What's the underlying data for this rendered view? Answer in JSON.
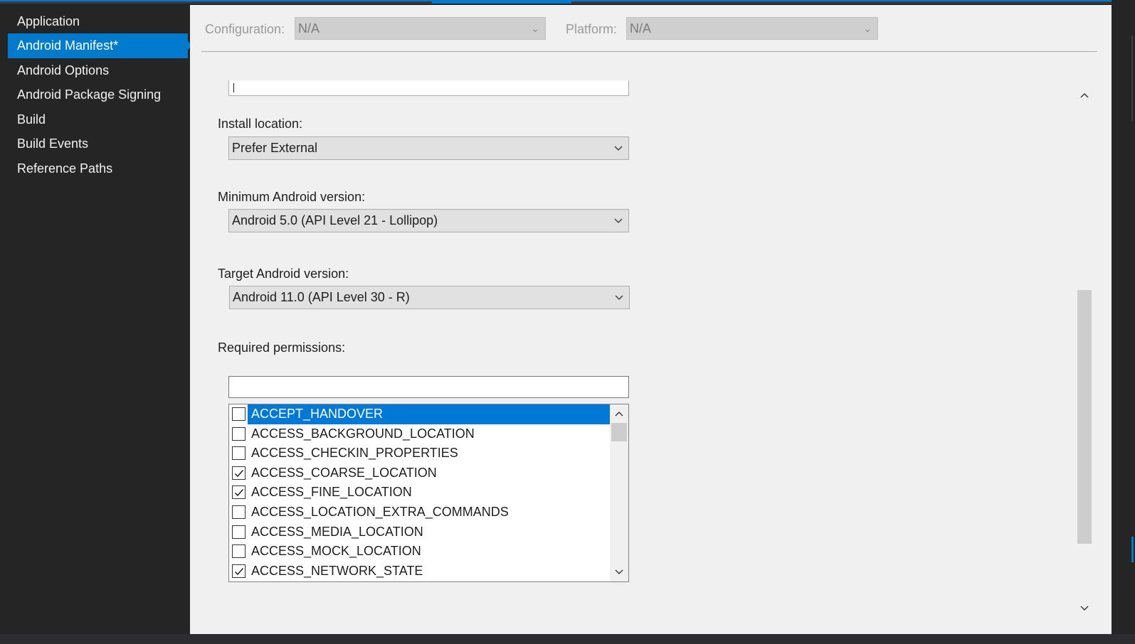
{
  "sidebar": {
    "items": [
      {
        "label": "Application",
        "active": false
      },
      {
        "label": "Android Manifest*",
        "active": true
      },
      {
        "label": "Android Options",
        "active": false
      },
      {
        "label": "Android Package Signing",
        "active": false
      },
      {
        "label": "Build",
        "active": false
      },
      {
        "label": "Build Events",
        "active": false
      },
      {
        "label": "Reference Paths",
        "active": false
      }
    ]
  },
  "toolbar": {
    "configuration_label": "Configuration:",
    "configuration_value": "N/A",
    "platform_label": "Platform:",
    "platform_value": "N/A"
  },
  "form": {
    "install_location_label": "Install location:",
    "install_location_value": "Prefer External",
    "min_android_label": "Minimum Android version:",
    "min_android_value": "Android 5.0 (API Level 21 - Lollipop)",
    "target_android_label": "Target Android version:",
    "target_android_value": "Android 11.0 (API Level 30 - R)",
    "permissions_label": "Required permissions:",
    "permissions_filter": ""
  },
  "permissions": [
    {
      "name": "ACCEPT_HANDOVER",
      "checked": false,
      "selected": true
    },
    {
      "name": "ACCESS_BACKGROUND_LOCATION",
      "checked": false,
      "selected": false
    },
    {
      "name": "ACCESS_CHECKIN_PROPERTIES",
      "checked": false,
      "selected": false
    },
    {
      "name": "ACCESS_COARSE_LOCATION",
      "checked": true,
      "selected": false
    },
    {
      "name": "ACCESS_FINE_LOCATION",
      "checked": true,
      "selected": false
    },
    {
      "name": "ACCESS_LOCATION_EXTRA_COMMANDS",
      "checked": false,
      "selected": false
    },
    {
      "name": "ACCESS_MEDIA_LOCATION",
      "checked": false,
      "selected": false
    },
    {
      "name": "ACCESS_MOCK_LOCATION",
      "checked": false,
      "selected": false
    },
    {
      "name": "ACCESS_NETWORK_STATE",
      "checked": true,
      "selected": false
    }
  ],
  "colors": {
    "accent": "#007acc",
    "selection": "#0078d7",
    "sidebar_bg": "#252526",
    "panel_bg": "#f0f0f0"
  },
  "icons": {
    "dropdown": "chevron-down-icon",
    "scroll_up": "chevron-up-icon",
    "scroll_down": "chevron-down-icon",
    "checkmark": "checkmark-icon"
  }
}
